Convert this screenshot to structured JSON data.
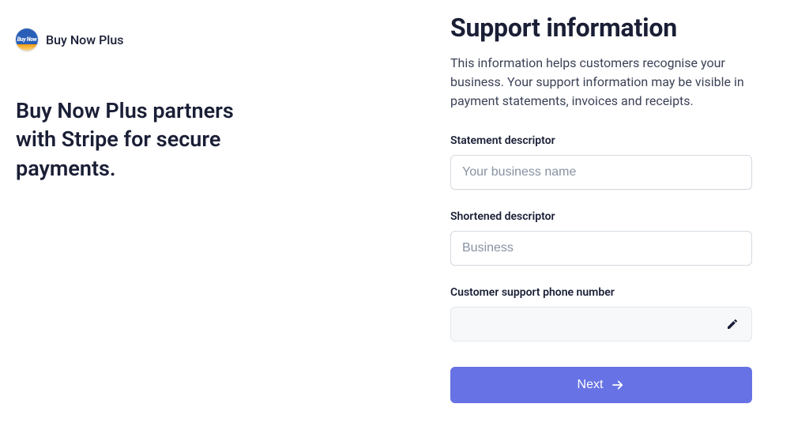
{
  "brand": {
    "name": "Buy Now Plus",
    "logo_text": "Buy Now"
  },
  "left": {
    "headline": "Buy Now Plus partners with Stripe for secure payments."
  },
  "right": {
    "title": "Support information",
    "description": "This information helps customers recognise your business. Your support information may be visible in payment statements, invoices and receipts.",
    "fields": {
      "statement": {
        "label": "Statement descriptor",
        "placeholder": "Your business name",
        "value": ""
      },
      "shortened": {
        "label": "Shortened descriptor",
        "placeholder": "Business",
        "value": ""
      },
      "phone": {
        "label": "Customer support phone number",
        "value": ""
      }
    },
    "next_label": "Next"
  }
}
